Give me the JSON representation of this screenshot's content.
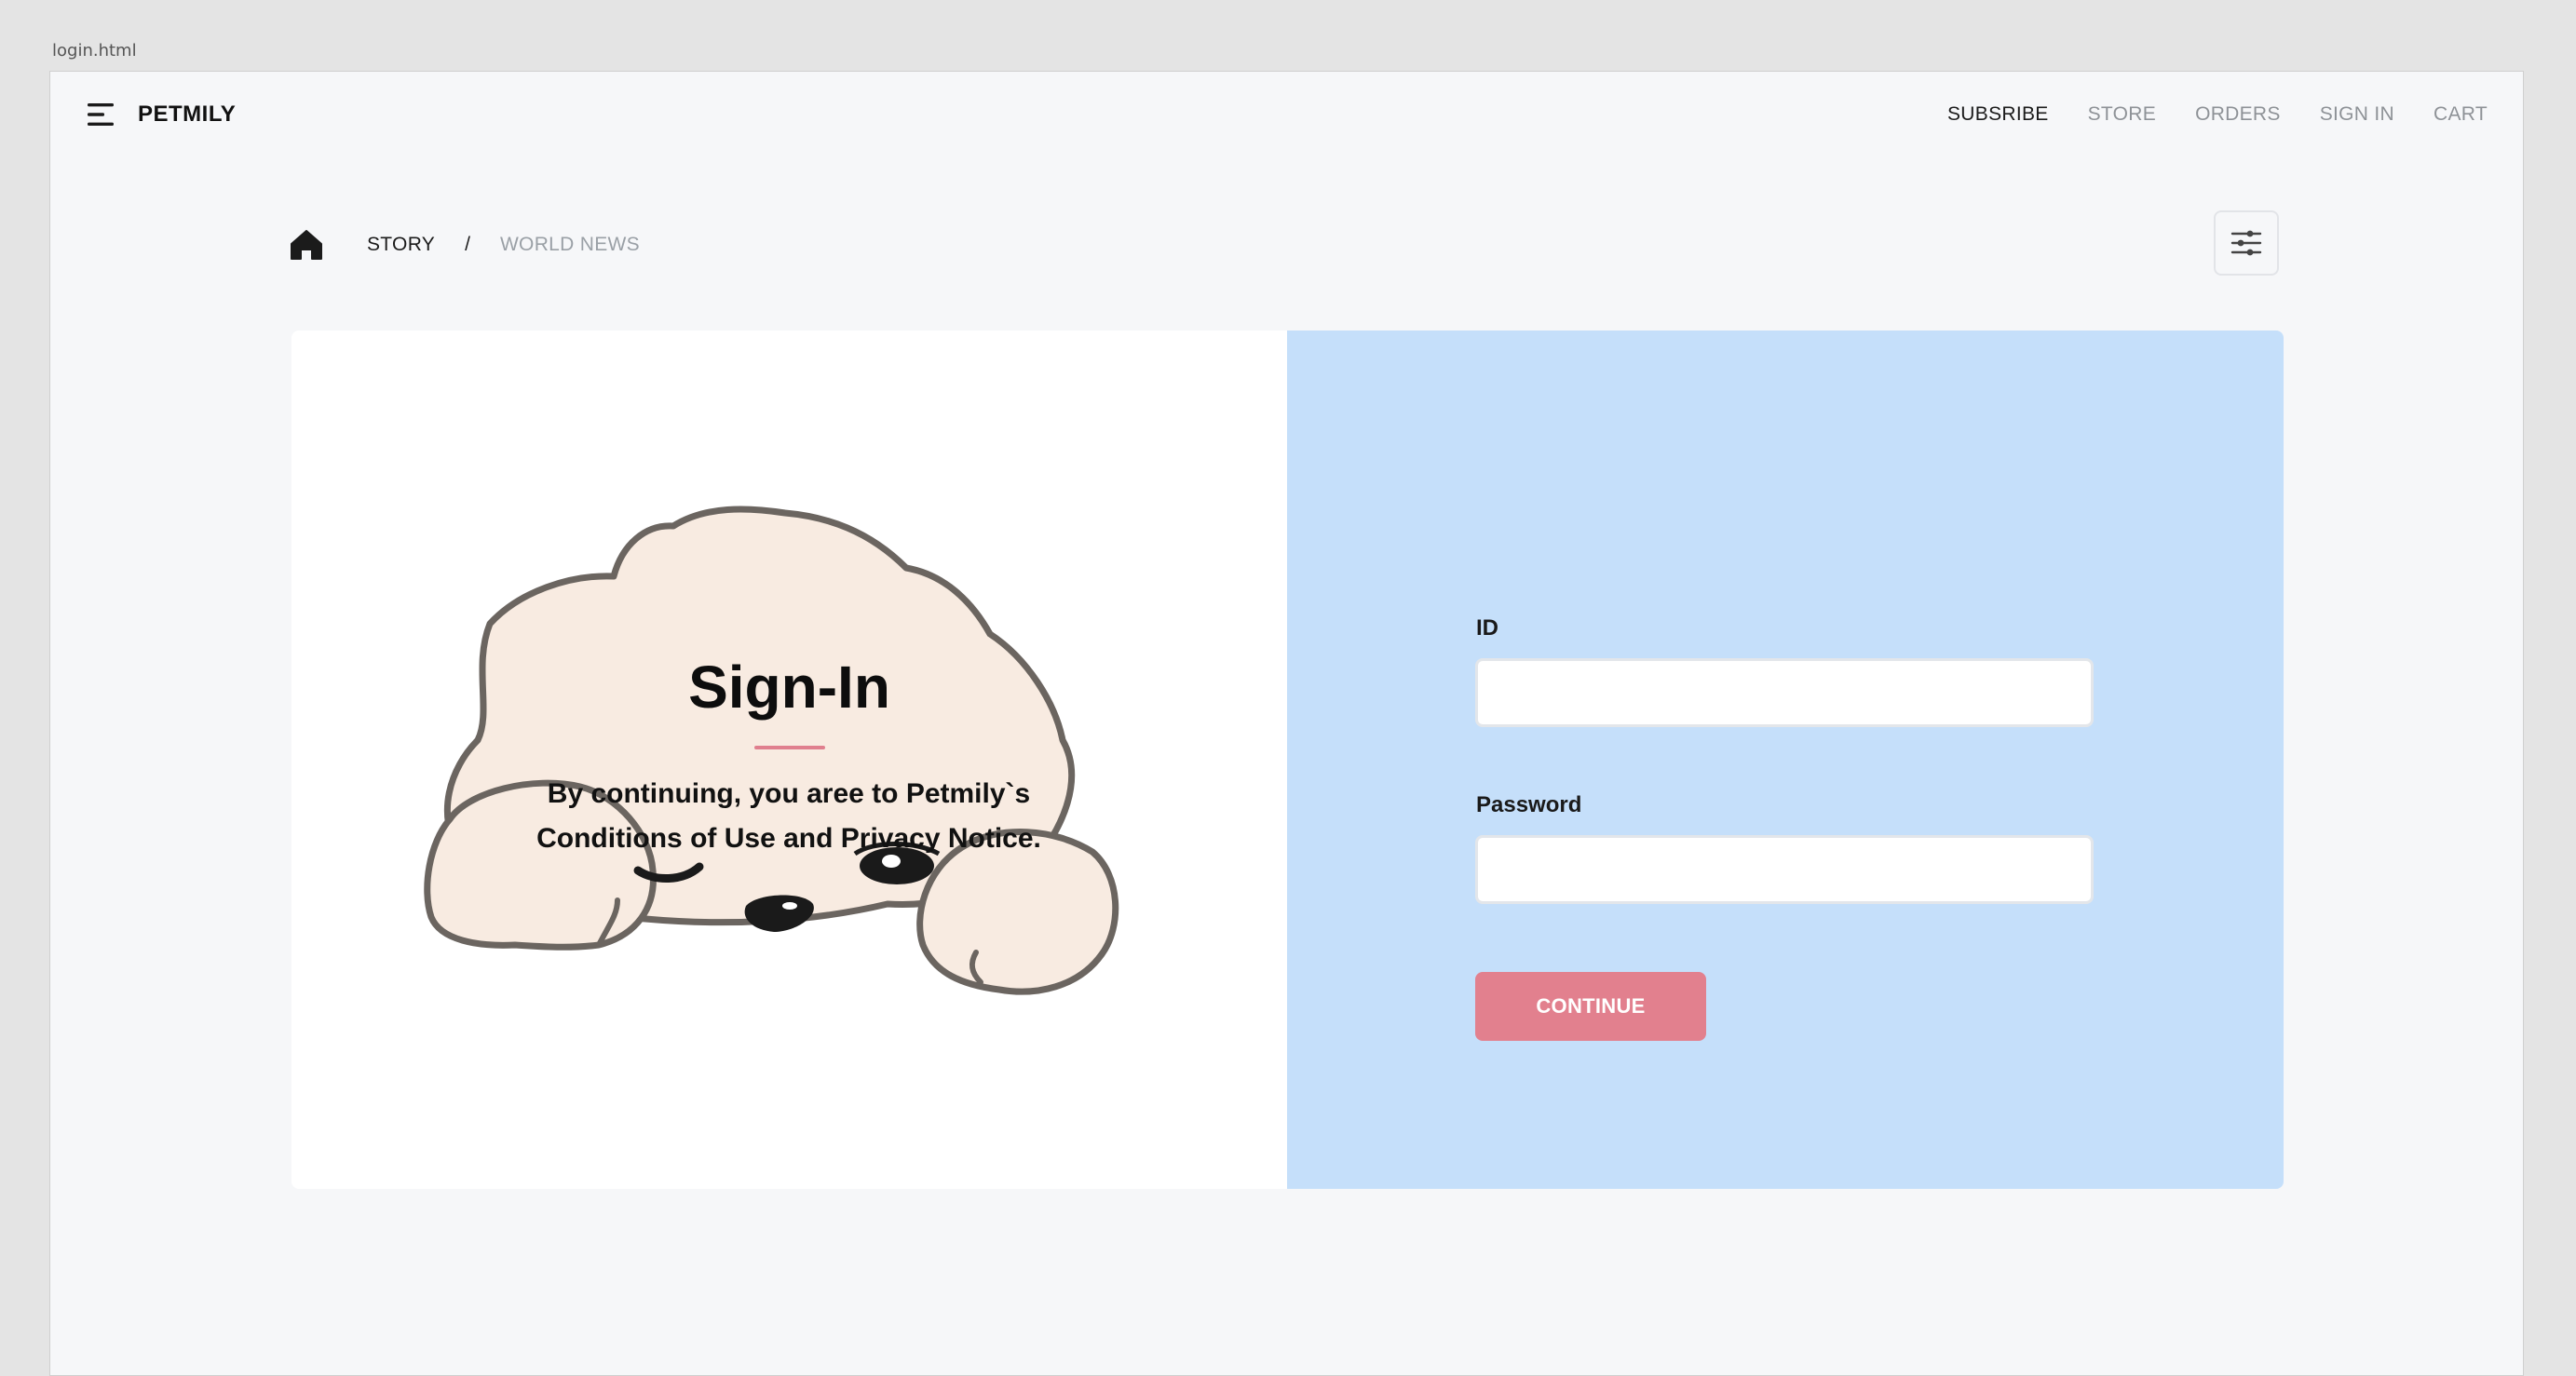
{
  "file_tab": "login.html",
  "brand": "PETMILY",
  "nav": {
    "items": [
      {
        "label": "SUBSRIBE",
        "active": true
      },
      {
        "label": "STORE",
        "active": false
      },
      {
        "label": "ORDERS",
        "active": false
      },
      {
        "label": "SIGN IN",
        "active": false
      },
      {
        "label": "CART",
        "active": false
      }
    ]
  },
  "breadcrumb": {
    "story": "STORY",
    "separator": "/",
    "current": "WORLD NEWS"
  },
  "signin": {
    "title": "Sign-In",
    "notice_line1": "By continuing, you aree to Petmily`s",
    "notice_line2": "Conditions of Use and Privacy Notice."
  },
  "form": {
    "id_label": "ID",
    "id_value": "",
    "password_label": "Password",
    "password_value": "",
    "continue_label": "CONTINUE"
  },
  "icons": {
    "menu": "menu-icon",
    "home": "home-icon",
    "filter": "sliders-icon",
    "illustration": "puppy-illustration"
  },
  "colors": {
    "page_bg": "#f6f7f9",
    "form_panel": "#c5dffa",
    "accent": "#e2808e",
    "illustration_fill": "#f8ebe1",
    "illustration_stroke": "#6b6560"
  }
}
